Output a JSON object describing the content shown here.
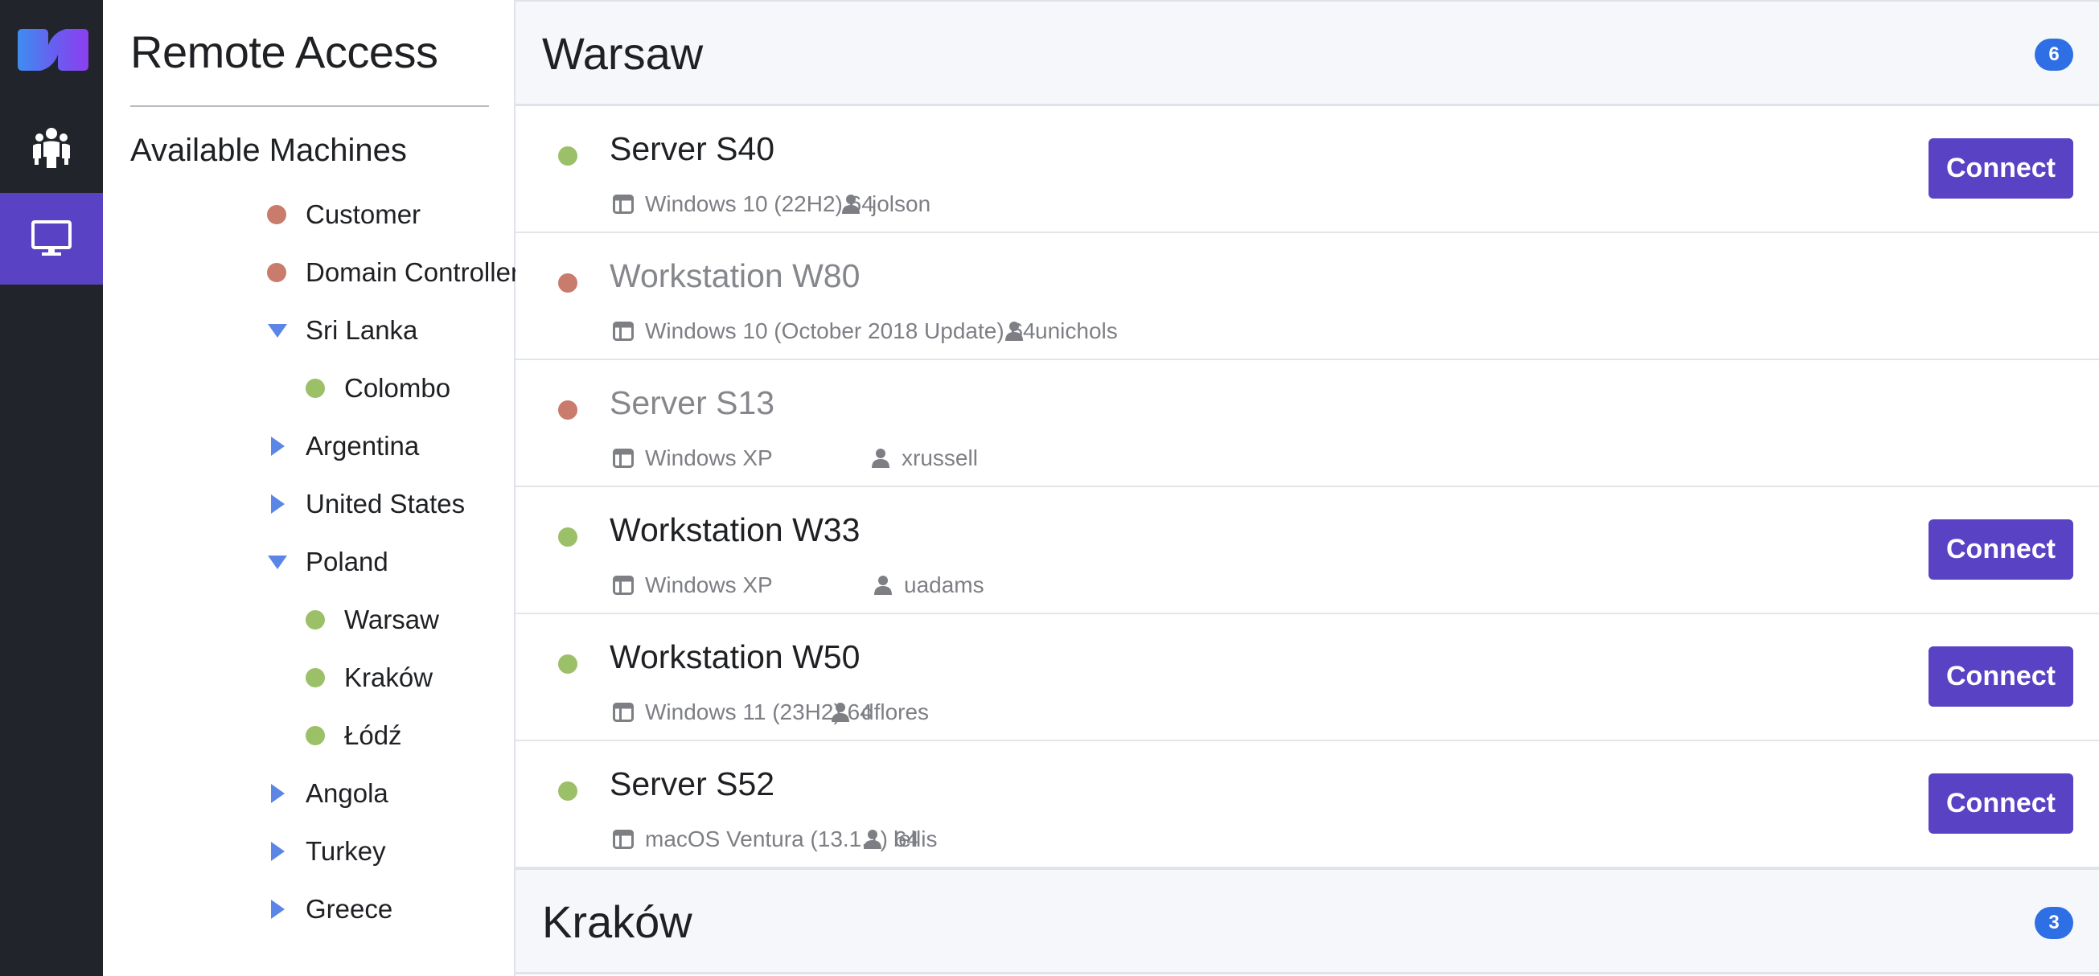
{
  "rail": {
    "logo_icon": "brand-logo",
    "items": [
      {
        "icon": "people-icon",
        "active": false
      },
      {
        "icon": "monitor-icon",
        "active": true
      }
    ]
  },
  "sidebar": {
    "title": "Remote Access",
    "section_title": "Available Machines",
    "tree": [
      {
        "label": "Customer",
        "kind": "dot",
        "status": "offline",
        "level": 0
      },
      {
        "label": "Domain Controllers",
        "kind": "dot",
        "status": "offline",
        "level": 0
      },
      {
        "label": "Sri Lanka",
        "kind": "expanded",
        "level": 0
      },
      {
        "label": "Colombo",
        "kind": "dot",
        "status": "online",
        "level": 1
      },
      {
        "label": "Argentina",
        "kind": "collapsed",
        "level": 0
      },
      {
        "label": "United States",
        "kind": "collapsed",
        "level": 0
      },
      {
        "label": "Poland",
        "kind": "expanded",
        "level": 0
      },
      {
        "label": "Warsaw",
        "kind": "dot",
        "status": "online",
        "level": 1
      },
      {
        "label": "Kraków",
        "kind": "dot",
        "status": "online",
        "level": 1
      },
      {
        "label": "Łódź",
        "kind": "dot",
        "status": "online",
        "level": 1
      },
      {
        "label": "Angola",
        "kind": "collapsed",
        "level": 0
      },
      {
        "label": "Turkey",
        "kind": "collapsed",
        "level": 0
      },
      {
        "label": "Greece",
        "kind": "collapsed",
        "level": 0
      }
    ]
  },
  "groups": [
    {
      "title": "Warsaw",
      "count": "6",
      "machines": [
        {
          "name": "Server S40",
          "os": "Windows 10 (22H2) 64",
          "user": "jolson",
          "online": true,
          "connect_label": "Connect"
        },
        {
          "name": "Workstation W80",
          "os": "Windows 10 (October 2018 Update) 64",
          "user": "unichols",
          "online": false
        },
        {
          "name": "Server S13",
          "os": "Windows XP",
          "user": "xrussell",
          "online": false
        },
        {
          "name": "Workstation W33",
          "os": "Windows XP",
          "user": "uadams",
          "online": true,
          "connect_label": "Connect"
        },
        {
          "name": "Workstation W50",
          "os": "Windows 11 (23H2) 64",
          "user": "dflores",
          "online": true,
          "connect_label": "Connect"
        },
        {
          "name": "Server S52",
          "os": "macOS Ventura (13.1.1) 64",
          "user": "lellis",
          "online": true,
          "connect_label": "Connect"
        }
      ]
    },
    {
      "title": "Kraków",
      "count": "3",
      "machines": []
    }
  ],
  "colors": {
    "rail_bg": "#21252b",
    "accent": "#5a42c4",
    "online": "#9bc067",
    "offline": "#c97b6c",
    "badge": "#2f6fe6",
    "tree_triangle": "#5b86e6"
  }
}
